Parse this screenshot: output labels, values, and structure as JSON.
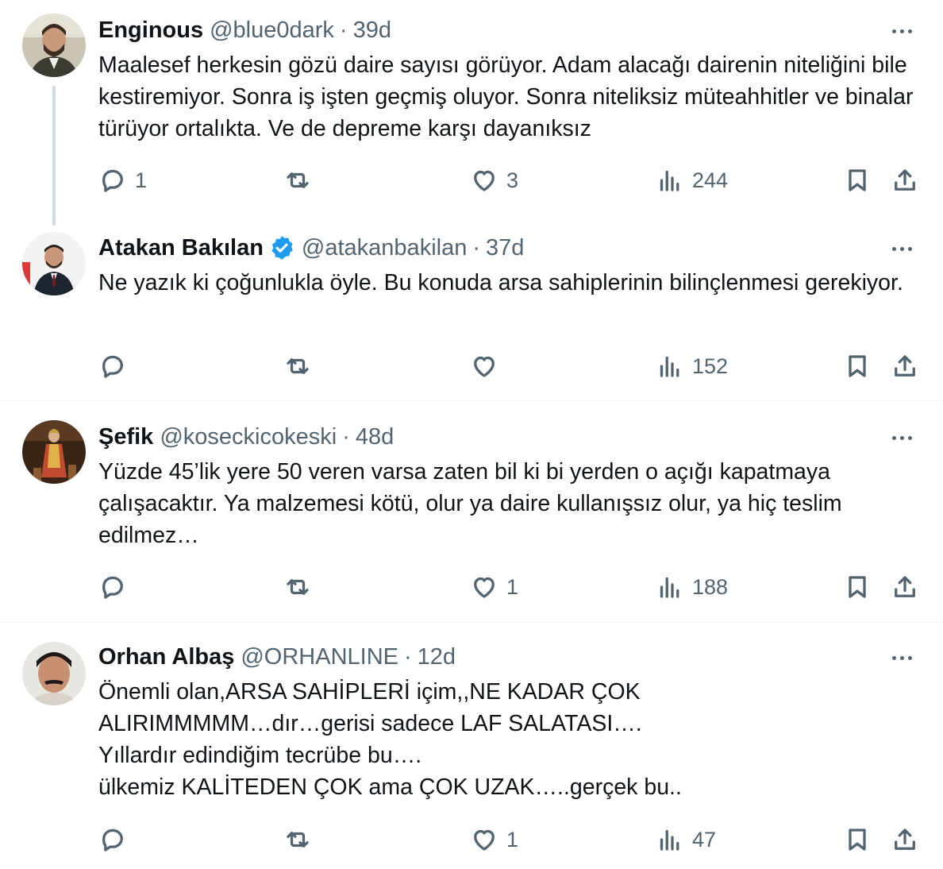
{
  "tweets": [
    {
      "name": "Enginous",
      "handle": "@blue0dark",
      "dot": "·",
      "time": "39d",
      "verified": false,
      "text": "Maalesef herkesin gözü daire sayısı görüyor. Adam alacağı dairenin niteliğini bile kestiremiyor. Sonra  iş işten geçmiş oluyor. Sonra niteliksiz müteahhitler ve binalar türüyor ortalıkta. Ve de depreme karşı dayanıksız",
      "replies": "1",
      "reposts": "",
      "likes": "3",
      "views": "244"
    },
    {
      "name": "Atakan Bakılan",
      "handle": "@atakanbakilan",
      "dot": "·",
      "time": "37d",
      "verified": true,
      "text": "Ne yazık ki çoğunlukla öyle. Bu konuda arsa sahiplerinin bilinçlenmesi gerekiyor.",
      "replies": "",
      "reposts": "",
      "likes": "",
      "views": "152"
    },
    {
      "name": "Şefik",
      "handle": "@koseckicokeski",
      "dot": "·",
      "time": "48d",
      "verified": false,
      "text": "Yüzde 45’lik yere 50 veren varsa zaten bil ki bi yerden o açığı kapatmaya çalışacaktır. Ya malzemesi kötü, olur ya daire kullanışsız olur, ya hiç teslim edilmez…",
      "replies": "",
      "reposts": "",
      "likes": "1",
      "views": "188"
    },
    {
      "name": "Orhan Albaş",
      "handle": "@ORHANLINE",
      "dot": "·",
      "time": "12d",
      "verified": false,
      "text": "Önemli olan,ARSA SAHİPLERİ içim,,NE KADAR ÇOK\nALIRIMMMMM…dır…gerisi sadece LAF SALATASI….\nYıllardır edindiğim tecrübe bu….\nülkemiz KALİTEDEN ÇOK ama ÇOK UZAK…..gerçek bu..",
      "replies": "",
      "reposts": "",
      "likes": "1",
      "views": "47"
    }
  ],
  "icons": {
    "reply": "reply-icon",
    "repost": "repost-icon",
    "like": "like-icon",
    "views": "views-icon",
    "bookmark": "bookmark-icon",
    "share": "share-icon",
    "more": "more-icon",
    "verified": "verified-badge-icon"
  },
  "colors": {
    "text": "#0f1419",
    "secondary": "#536471",
    "verified": "#1d9bf0",
    "divider": "#eff3f4",
    "thread_line": "#cfd9de"
  }
}
